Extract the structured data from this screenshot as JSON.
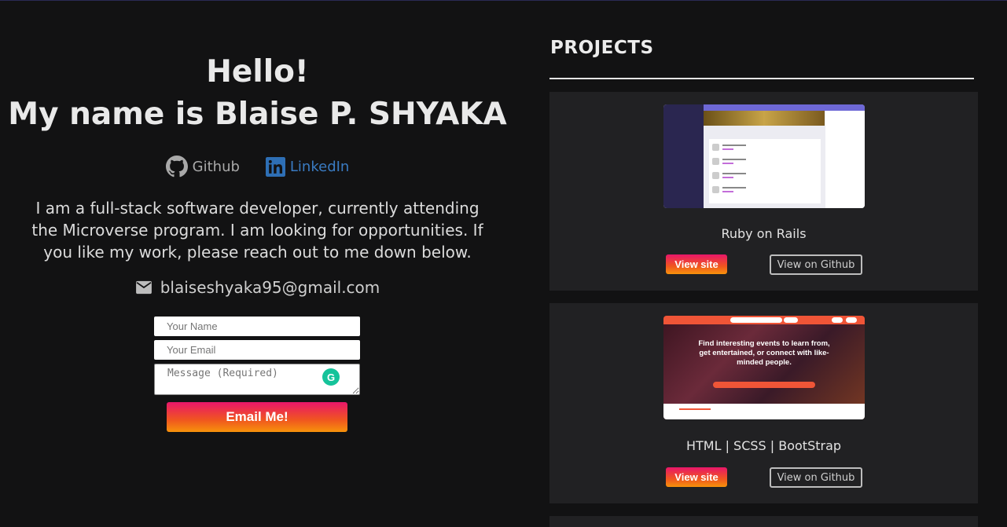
{
  "intro": {
    "greeting": "Hello!",
    "name_line": "My name is Blaise P. SHYAKA",
    "bio": "I am a full-stack software developer, currently attending the Microverse program. I am looking for opportunities. If you like my work, please reach out to me down below."
  },
  "social": {
    "github_label": "Github",
    "linkedin_label": "LinkedIn"
  },
  "contact": {
    "email": "blaiseshyaka95@gmail.com",
    "name_placeholder": "Your Name",
    "email_placeholder": "Your Email",
    "message_placeholder": "Message (Required)",
    "submit_label": "Email Me!"
  },
  "projects": {
    "heading": "PROJECTS",
    "items": [
      {
        "title": "Ruby on Rails",
        "site_label": "View site",
        "github_label": "View on Github"
      },
      {
        "title": "HTML | SCSS | BootStrap",
        "site_label": "View site",
        "github_label": "View on Github",
        "thumb_headline": "Find interesting events to learn from, get entertained, or connect with like-minded people."
      }
    ]
  },
  "colors": {
    "background": "#121213",
    "card": "#212123",
    "accent_gradient_start": "#e8166a",
    "accent_gradient_end": "#f7930b",
    "linkedin": "#3a7bc2"
  }
}
